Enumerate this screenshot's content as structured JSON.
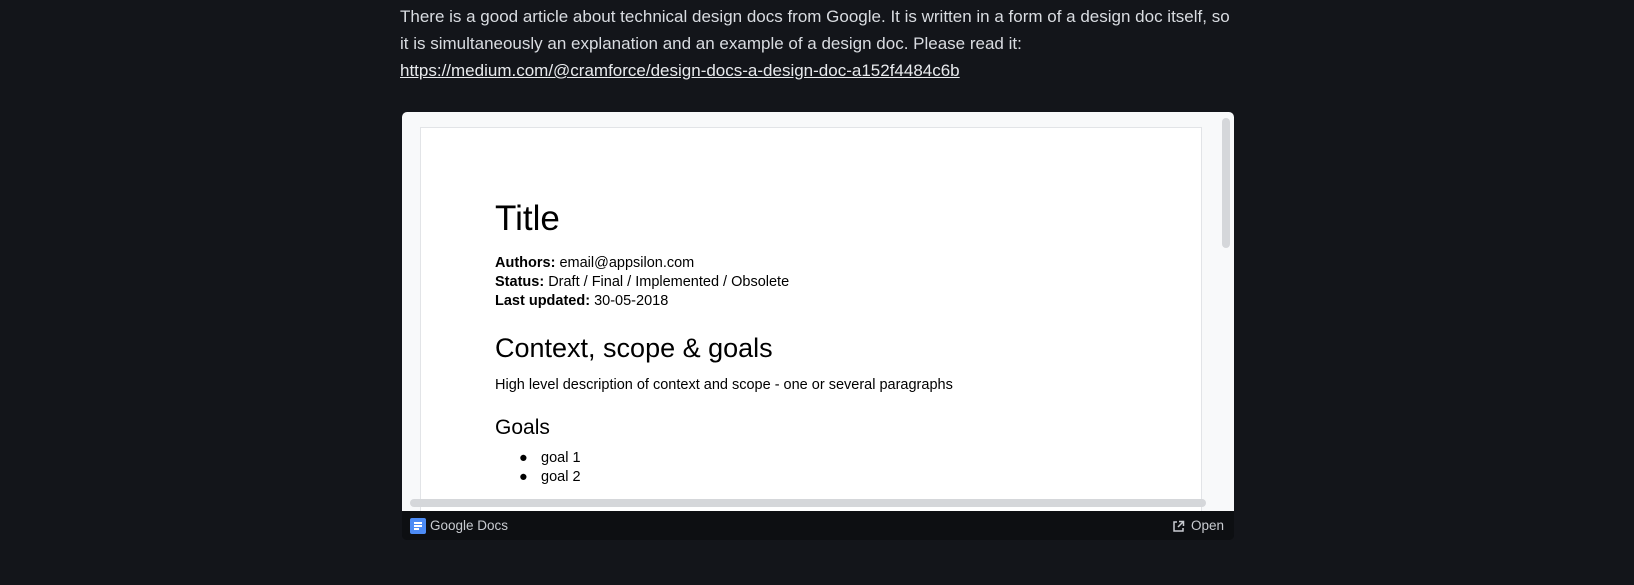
{
  "article": {
    "text": "There is a good article about technical design docs from Google. It is written in a form of a design doc itself, so it is simultaneously an explanation and an example of a design doc. Please read it:",
    "link": "https://medium.com/@cramforce/design-docs-a-design-doc-a152f4484c6b"
  },
  "embed": {
    "doc": {
      "title": "Title",
      "meta": [
        {
          "label": "Authors:",
          "value": "email@appsilon.com"
        },
        {
          "label": "Status:",
          "value": "Draft / Final / Implemented / Obsolete"
        },
        {
          "label": "Last updated:",
          "value": "30-05-2018"
        }
      ],
      "section_heading": "Context, scope & goals",
      "section_text": "High level description of context and scope - one or several paragraphs",
      "goals_heading": "Goals",
      "goals": [
        "goal 1",
        "goal 2"
      ]
    },
    "footer": {
      "source": "Google Docs",
      "open_label": "Open"
    }
  },
  "colors": {
    "page_background": "#13151a",
    "viewer_background": "#f8f9fa",
    "google_docs_blue": "#4c8bf5"
  },
  "icons": {
    "source": "google-docs-icon",
    "open": "external-link-icon"
  }
}
